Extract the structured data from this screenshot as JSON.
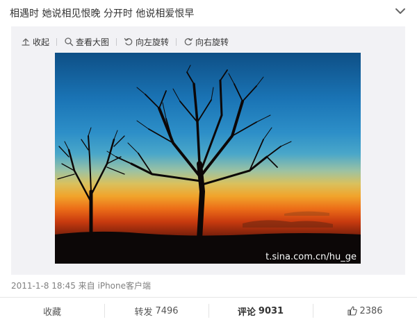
{
  "post": {
    "text": "相遇时 她说相见恨晚 分开时 他说相爱恨早"
  },
  "toolbar": {
    "items": [
      {
        "label": "收起",
        "icon": "collapse-up-icon"
      },
      {
        "label": "查看大图",
        "icon": "magnifier-icon"
      },
      {
        "label": "向左旋转",
        "icon": "rotate-left-icon"
      },
      {
        "label": "向右旋转",
        "icon": "rotate-right-icon"
      }
    ]
  },
  "photo": {
    "watermark": "t.sina.com.cn/hu_ge"
  },
  "meta": {
    "timestamp_source": "2011-1-8 18:45 来自 iPhone客户端"
  },
  "actions": {
    "favorite": {
      "label": "收藏"
    },
    "repost": {
      "label": "转发",
      "count": "7496"
    },
    "comment": {
      "label": "评论",
      "count": "9031"
    },
    "like": {
      "count": "2386"
    }
  },
  "colors": {
    "media_bg": "#f2f2f5",
    "meta_text": "#808080",
    "divider": "#e6e6e6"
  }
}
